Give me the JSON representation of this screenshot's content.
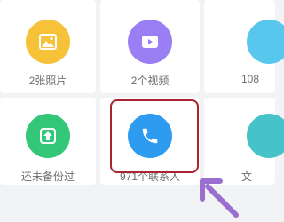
{
  "tiles": [
    {
      "label": "2张照片",
      "icon": "photo-icon",
      "color": "#f6c23a"
    },
    {
      "label": "2个视频",
      "icon": "video-icon",
      "color": "#9a7ef3"
    },
    {
      "label": "108",
      "icon": "music-icon",
      "color": "#58c7ee"
    },
    {
      "label": "还未备份过",
      "icon": "backup-upload-icon",
      "color": "#33c77a"
    },
    {
      "label": "971个联系人",
      "icon": "phone-icon",
      "color": "#2d9bf0"
    },
    {
      "label": "文",
      "icon": "file-icon",
      "color": "#45c3c9"
    }
  ],
  "highlight": {
    "color": "#a8242f",
    "target": "971个联系人"
  },
  "arrow": {
    "color": "#9b6fcf",
    "icon": "pointer-arrow-icon"
  }
}
